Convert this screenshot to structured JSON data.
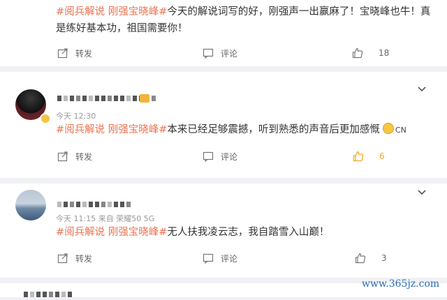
{
  "comments": [
    {
      "tags": "#阅兵解说 刚强宝晓峰#",
      "text": "今天的解说词写的好，刚强声一出赢麻了！宝晓峰也牛！真是练好基本功，祖国需要你！",
      "actions": {
        "share": "转发",
        "comment": "评论",
        "like_count": "18"
      }
    },
    {
      "time": "今天 12:30",
      "tags": "#阅兵解说 刚强宝晓峰#",
      "text": "本来已经足够震撼，听到熟悉的声音后更加感慨",
      "region": "CN",
      "actions": {
        "share": "转发",
        "comment": "评论",
        "like_count": "6"
      }
    },
    {
      "time": "今天 11:15",
      "source": "来自 荣耀50 5G",
      "tags": "#阅兵解说 刚强宝晓峰#",
      "text": "无人扶我凌云志，我自踏雪入山巅！",
      "actions": {
        "share": "转发",
        "comment": "评论",
        "like_count": "3"
      }
    }
  ],
  "watermark": "www.365jz.com",
  "colors": {
    "tag": "#eb7350",
    "like_active": "#f5a623",
    "background": "#eff1f4"
  }
}
